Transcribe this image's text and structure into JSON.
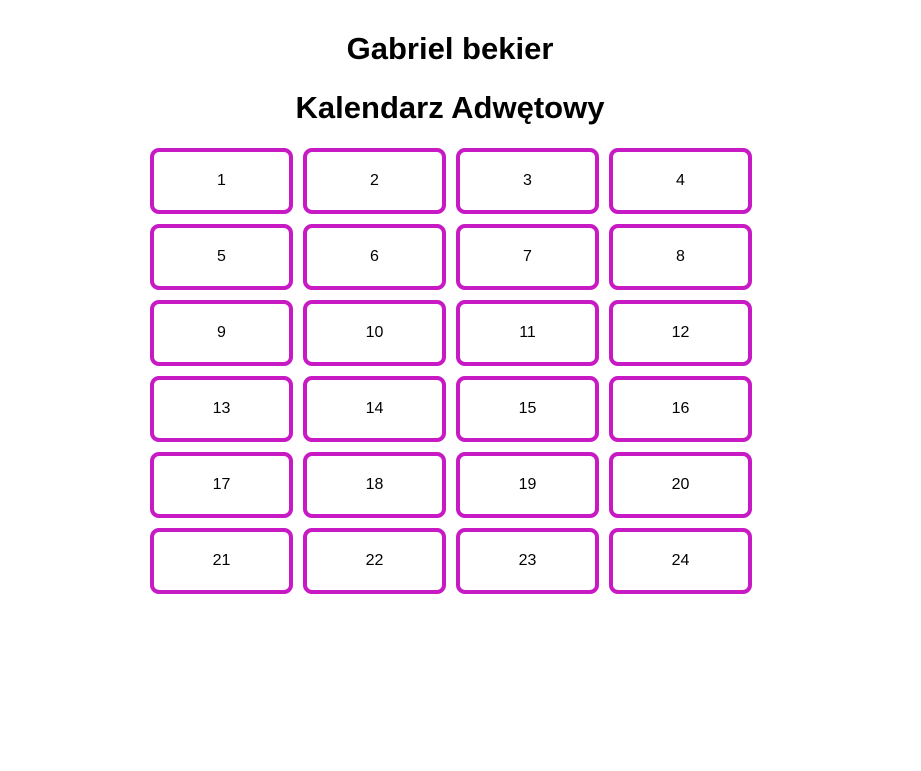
{
  "header": {
    "author": "Gabriel bekier",
    "title": "Kalendarz Adwętowy"
  },
  "calendar": {
    "days": [
      "1",
      "2",
      "3",
      "4",
      "5",
      "6",
      "7",
      "8",
      "9",
      "10",
      "11",
      "12",
      "13",
      "14",
      "15",
      "16",
      "17",
      "18",
      "19",
      "20",
      "21",
      "22",
      "23",
      "24"
    ]
  },
  "colors": {
    "accent": "#c71ac4",
    "background": "#ffffff",
    "text": "#000000"
  }
}
